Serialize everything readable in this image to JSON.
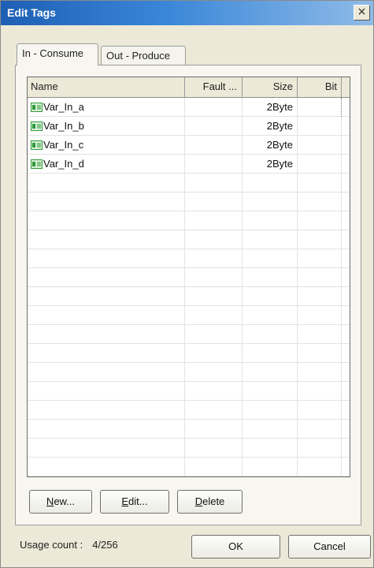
{
  "window": {
    "title": "Edit Tags",
    "close_glyph": "×"
  },
  "tabs": [
    {
      "label": "In - Consume",
      "active": true
    },
    {
      "label": "Out - Produce",
      "active": false
    }
  ],
  "table": {
    "columns": [
      "Name",
      "Fault ...",
      "Size",
      "Bit"
    ],
    "rows": [
      {
        "name": "Var_In_a",
        "fault": "",
        "size": "2Byte",
        "bit": "",
        "icon": "tag-variable-icon"
      },
      {
        "name": "Var_In_b",
        "fault": "",
        "size": "2Byte",
        "bit": "",
        "icon": "tag-variable-icon"
      },
      {
        "name": "Var_In_c",
        "fault": "",
        "size": "2Byte",
        "bit": "",
        "icon": "tag-variable-icon"
      },
      {
        "name": "Var_In_d",
        "fault": "",
        "size": "2Byte",
        "bit": "",
        "icon": "tag-variable-icon"
      }
    ],
    "empty_row_count": 16
  },
  "actions": {
    "new": "New...",
    "edit": "Edit...",
    "delete": "Delete"
  },
  "footer": {
    "usage_label": "Usage count :",
    "usage_value": "4/256",
    "ok": "OK",
    "cancel": "Cancel"
  },
  "colors": {
    "title_bar": "#1d5fb4",
    "dialog_bg": "#ece9d8",
    "icon_green": "#2f9a3a"
  }
}
